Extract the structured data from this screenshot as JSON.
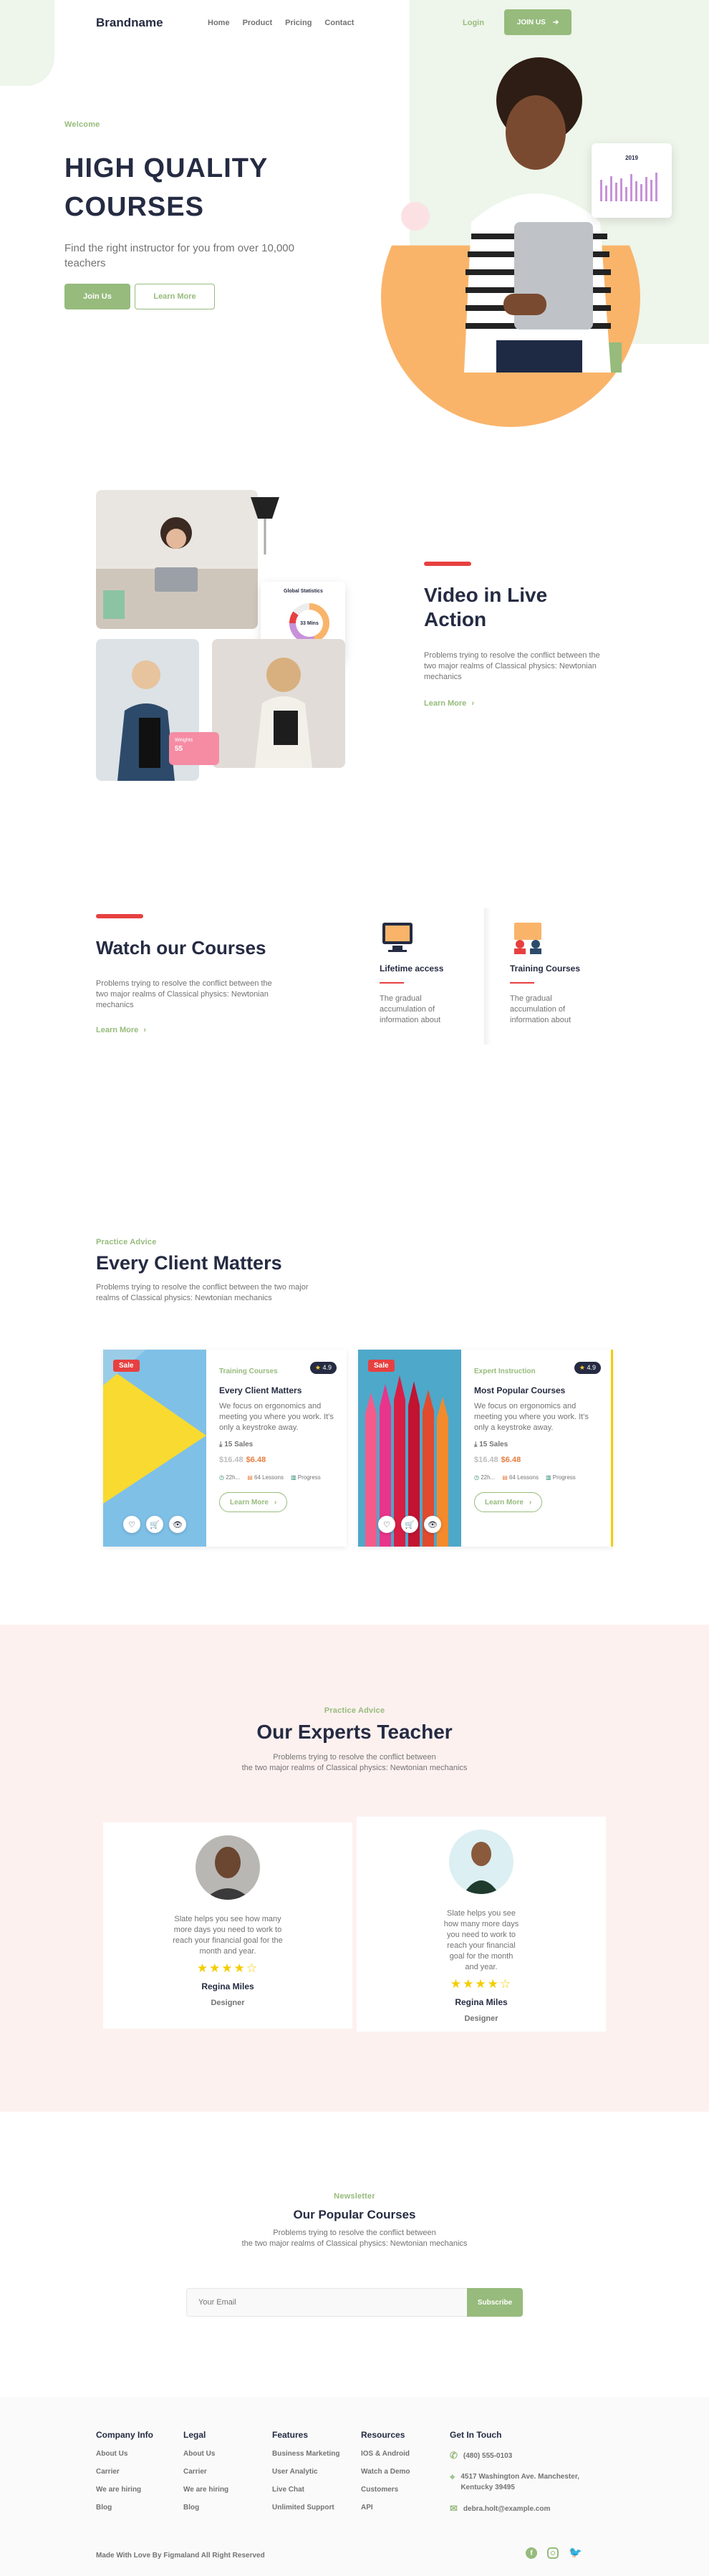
{
  "brand": "Brandname",
  "nav": {
    "links": [
      "Home",
      "Product",
      "Pricing",
      "Contact"
    ],
    "login": "Login",
    "join": "JOIN US"
  },
  "hero": {
    "eyebrow": "Welcome",
    "title_line1": "HIGH QUALITY",
    "title_line2": "COURSES",
    "subtitle": "Find the right instructor for you from over 10,000 teachers",
    "primary_btn": "Join Us",
    "secondary_btn": "Learn More",
    "chart_year": "2019"
  },
  "video": {
    "title": "Video in Live Action",
    "desc": "Problems trying to resolve the conflict between the two major realms of Classical physics: Newtonian mechanics",
    "link": "Learn More",
    "stats_title": "Global Statistics",
    "stats_value": "33 Mins",
    "badge_label": "Weights",
    "badge_value": "55"
  },
  "watch": {
    "title": "Watch our Courses",
    "desc": "Problems trying to resolve the conflict between the two major realms of Classical physics: Newtonian mechanics",
    "link": "Learn More",
    "features": [
      {
        "title": "Lifetime access",
        "desc": "The gradual accumulation of information about"
      },
      {
        "title": "Training Courses",
        "desc": "The gradual accumulation of information about"
      }
    ]
  },
  "client": {
    "eyebrow": "Practice Advice",
    "title": "Every Client Matters",
    "desc": "Problems trying to resolve the conflict between the two major realms of Classical physics: Newtonian mechanics"
  },
  "courses": [
    {
      "sale": "Sale",
      "category": "Training Courses",
      "rating": "4.9",
      "title": "Every Client Matters",
      "desc": "We focus on ergonomics and meeting you where you work. It's only a keystroke away.",
      "sales": "15 Sales",
      "old_price": "$16.48",
      "new_price": "$6.48",
      "duration": "22h...",
      "lessons": "64 Lessons",
      "progress": "Progress",
      "button": "Learn More"
    },
    {
      "sale": "Sale",
      "category": "Expert Instruction",
      "rating": "4.9",
      "title": "Most Popular Courses",
      "desc": "We focus on ergonomics and meeting you where you work. It's only a keystroke away.",
      "sales": "15 Sales",
      "old_price": "$16.48",
      "new_price": "$6.48",
      "duration": "22h...",
      "lessons": "64 Lessons",
      "progress": "Progress",
      "button": "Learn More"
    }
  ],
  "experts": {
    "eyebrow": "Practice Advice",
    "title": "Our Experts Teacher",
    "desc_line1": "Problems trying to resolve the conflict between",
    "desc_line2": "the two major realms of Classical physics: Newtonian mechanics",
    "teachers": [
      {
        "quote": "Slate helps you see how many more days you need to work to reach your financial goal for the month and year.",
        "rating": 4,
        "name": "Regina Miles",
        "role": "Designer"
      },
      {
        "quote": "Slate helps you see how many more days you need to work to reach your financial goal for the month and year.",
        "rating": 4,
        "name": "Regina Miles",
        "role": "Designer"
      }
    ]
  },
  "newsletter": {
    "eyebrow": "Newsletter",
    "title": "Our Popular Courses",
    "desc_line1": "Problems trying to resolve the conflict between",
    "desc_line2": "the two major realms of Classical physics: Newtonian mechanics",
    "placeholder": "Your Email",
    "button": "Subscribe"
  },
  "footer": {
    "columns": [
      {
        "title": "Company Info",
        "links": [
          "About Us",
          "Carrier",
          "We are hiring",
          "Blog"
        ]
      },
      {
        "title": "Legal",
        "links": [
          "About Us",
          "Carrier",
          "We are hiring",
          "Blog"
        ]
      },
      {
        "title": "Features",
        "links": [
          "Business Marketing",
          "User Analytic",
          "Live Chat",
          "Unlimited Support"
        ]
      },
      {
        "title": "Resources",
        "links": [
          "IOS & Android",
          "Watch a Demo",
          "Customers",
          "API"
        ]
      }
    ],
    "contact_title": "Get In Touch",
    "phone": "(480) 555-0103",
    "address_line1": "4517 Washington Ave. Manchester,",
    "address_line2": "Kentucky 39495",
    "email": "debra.holt@example.com",
    "copyright": "Made With Love By Figmaland All Right Reserved"
  },
  "colors": {
    "accent": "#96BB7C",
    "dark": "#252B42",
    "muted": "#737373",
    "red": "#E74040",
    "orange": "#E77C40",
    "pink_bg": "#FDF1F0"
  }
}
